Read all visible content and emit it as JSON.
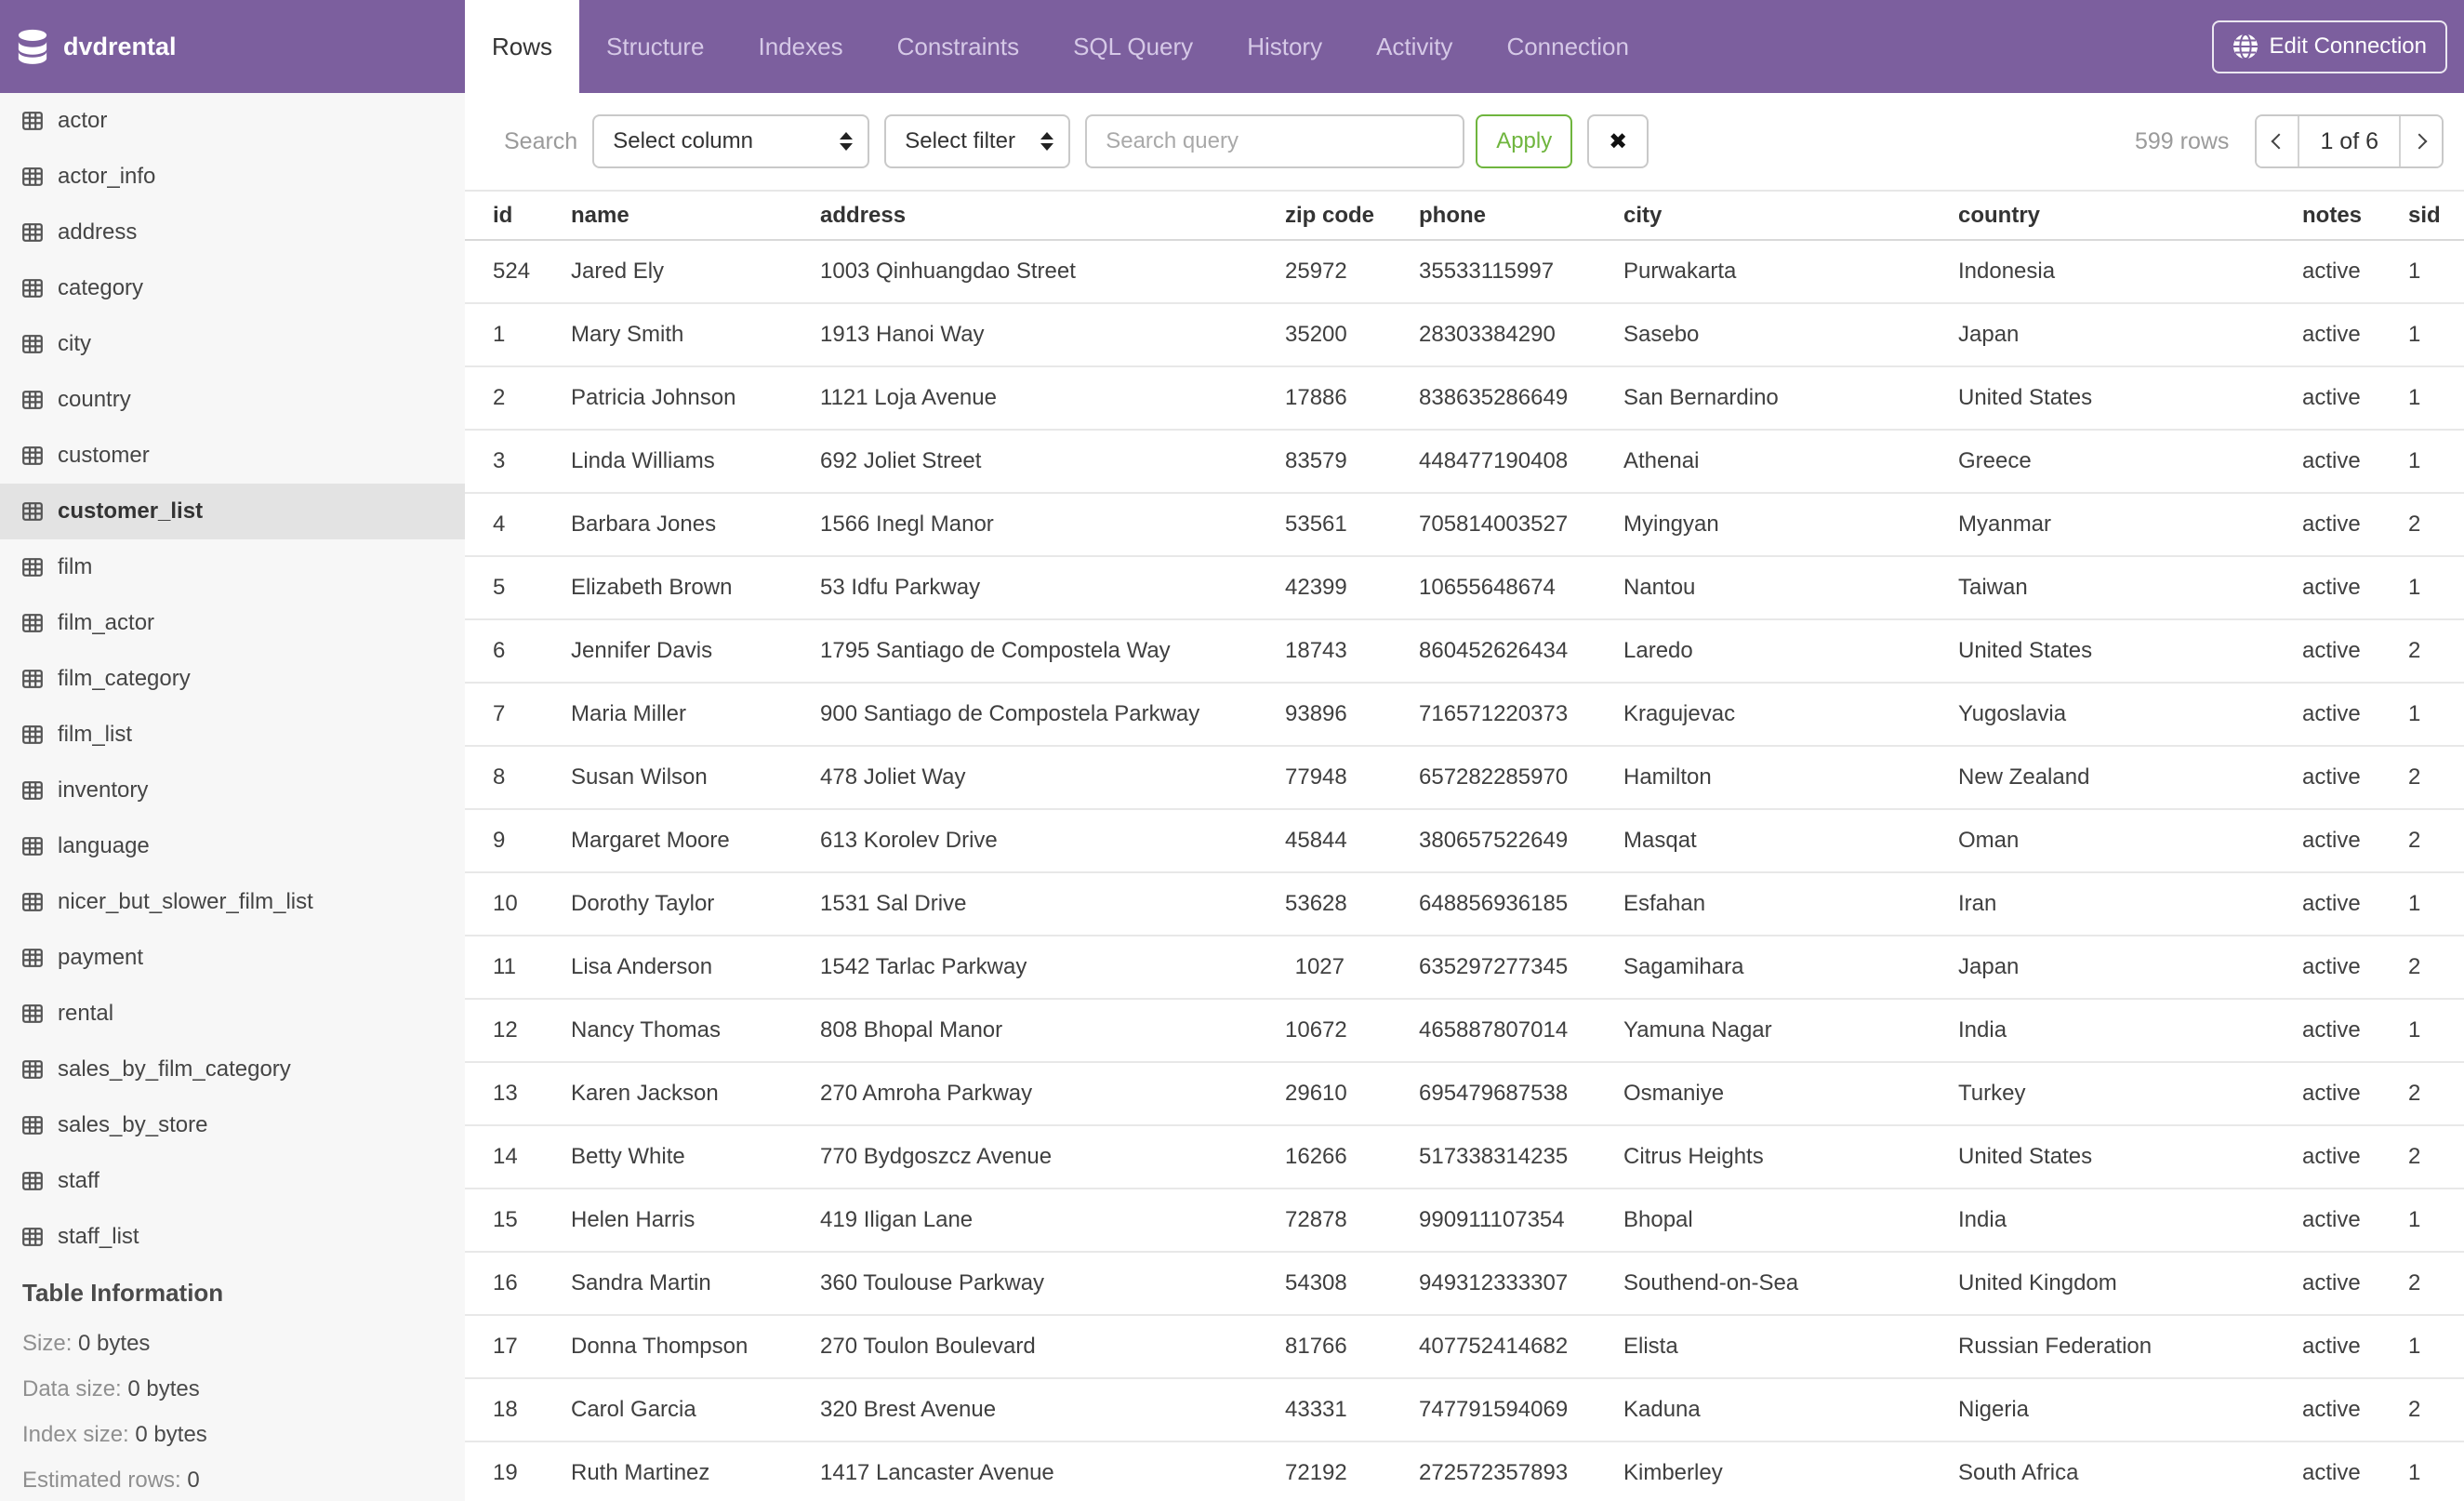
{
  "header": {
    "title": "dvdrental",
    "tabs": [
      {
        "label": "Rows",
        "active": true
      },
      {
        "label": "Structure",
        "active": false
      },
      {
        "label": "Indexes",
        "active": false
      },
      {
        "label": "Constraints",
        "active": false
      },
      {
        "label": "SQL Query",
        "active": false
      },
      {
        "label": "History",
        "active": false
      },
      {
        "label": "Activity",
        "active": false
      },
      {
        "label": "Connection",
        "active": false
      }
    ],
    "edit_connection_label": "Edit Connection"
  },
  "sidebar": {
    "tables": [
      "actor",
      "actor_info",
      "address",
      "category",
      "city",
      "country",
      "customer",
      "customer_list",
      "film",
      "film_actor",
      "film_category",
      "film_list",
      "inventory",
      "language",
      "nicer_but_slower_film_list",
      "payment",
      "rental",
      "sales_by_film_category",
      "sales_by_store",
      "staff",
      "staff_list"
    ],
    "selected_table": "customer_list",
    "info": {
      "heading": "Table Information",
      "rows": [
        {
          "label": "Size:",
          "value": "0 bytes"
        },
        {
          "label": "Data size:",
          "value": "0 bytes"
        },
        {
          "label": "Index size:",
          "value": "0 bytes"
        },
        {
          "label": "Estimated rows:",
          "value": "0"
        }
      ]
    }
  },
  "toolbar": {
    "search_label": "Search",
    "column_select_value": "Select column",
    "filter_select_value": "Select filter",
    "query_placeholder": "Search query",
    "apply_label": "Apply",
    "clear_label": "✖",
    "row_count": "599 rows",
    "page_indicator": "1 of 6"
  },
  "table": {
    "columns": [
      "id",
      "name",
      "address",
      "zip code",
      "phone",
      "city",
      "country",
      "notes",
      "sid"
    ],
    "rows": [
      [
        "524",
        "Jared Ely",
        "1003 Qinhuangdao Street",
        "25972",
        "35533115997",
        "Purwakarta",
        "Indonesia",
        "active",
        "1"
      ],
      [
        "1",
        "Mary Smith",
        "1913 Hanoi Way",
        "35200",
        "28303384290",
        "Sasebo",
        "Japan",
        "active",
        "1"
      ],
      [
        "2",
        "Patricia Johnson",
        "1121 Loja Avenue",
        "17886",
        "838635286649",
        "San Bernardino",
        "United States",
        "active",
        "1"
      ],
      [
        "3",
        "Linda Williams",
        "692 Joliet Street",
        "83579",
        "448477190408",
        "Athenai",
        "Greece",
        "active",
        "1"
      ],
      [
        "4",
        "Barbara Jones",
        "1566 Inegl Manor",
        "53561",
        "705814003527",
        "Myingyan",
        "Myanmar",
        "active",
        "2"
      ],
      [
        "5",
        "Elizabeth Brown",
        "53 Idfu Parkway",
        "42399",
        "10655648674",
        "Nantou",
        "Taiwan",
        "active",
        "1"
      ],
      [
        "6",
        "Jennifer Davis",
        "1795 Santiago de Compostela Way",
        "18743",
        "860452626434",
        "Laredo",
        "United States",
        "active",
        "2"
      ],
      [
        "7",
        "Maria Miller",
        "900 Santiago de Compostela Parkway",
        "93896",
        "716571220373",
        "Kragujevac",
        "Yugoslavia",
        "active",
        "1"
      ],
      [
        "8",
        "Susan Wilson",
        "478 Joliet Way",
        "77948",
        "657282285970",
        "Hamilton",
        "New Zealand",
        "active",
        "2"
      ],
      [
        "9",
        "Margaret Moore",
        "613 Korolev Drive",
        "45844",
        "380657522649",
        "Masqat",
        "Oman",
        "active",
        "2"
      ],
      [
        "10",
        "Dorothy Taylor",
        "1531 Sal Drive",
        "53628",
        "648856936185",
        "Esfahan",
        "Iran",
        "active",
        "1"
      ],
      [
        "11",
        "Lisa Anderson",
        "1542 Tarlac Parkway",
        "1027",
        "635297277345",
        "Sagamihara",
        "Japan",
        "active",
        "2"
      ],
      [
        "12",
        "Nancy Thomas",
        "808 Bhopal Manor",
        "10672",
        "465887807014",
        "Yamuna Nagar",
        "India",
        "active",
        "1"
      ],
      [
        "13",
        "Karen Jackson",
        "270 Amroha Parkway",
        "29610",
        "695479687538",
        "Osmaniye",
        "Turkey",
        "active",
        "2"
      ],
      [
        "14",
        "Betty White",
        "770 Bydgoszcz Avenue",
        "16266",
        "517338314235",
        "Citrus Heights",
        "United States",
        "active",
        "2"
      ],
      [
        "15",
        "Helen Harris",
        "419 Iligan Lane",
        "72878",
        "990911107354",
        "Bhopal",
        "India",
        "active",
        "1"
      ],
      [
        "16",
        "Sandra Martin",
        "360 Toulouse Parkway",
        "54308",
        "949312333307",
        "Southend-on-Sea",
        "United Kingdom",
        "active",
        "2"
      ],
      [
        "17",
        "Donna Thompson",
        "270 Toulon Boulevard",
        "81766",
        "407752414682",
        "Elista",
        "Russian Federation",
        "active",
        "1"
      ],
      [
        "18",
        "Carol Garcia",
        "320 Brest Avenue",
        "43331",
        "747791594069",
        "Kaduna",
        "Nigeria",
        "active",
        "2"
      ],
      [
        "19",
        "Ruth Martinez",
        "1417 Lancaster Avenue",
        "72192",
        "272572357893",
        "Kimberley",
        "South Africa",
        "active",
        "1"
      ]
    ]
  },
  "colors": {
    "purple": "#7c5f9e",
    "green": "#6fb53e"
  }
}
